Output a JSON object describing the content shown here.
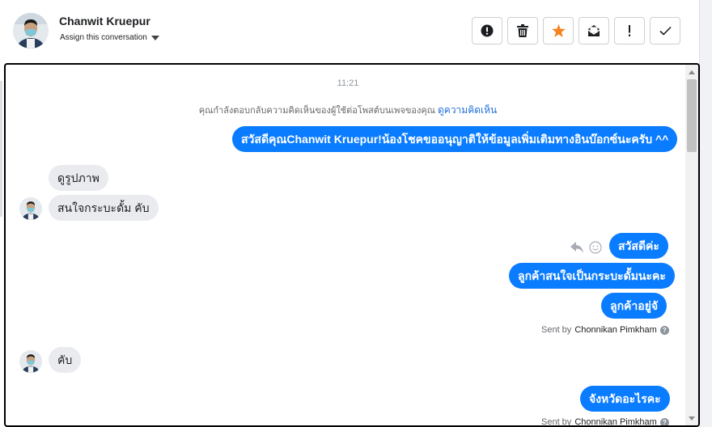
{
  "header": {
    "contact_name": "Chanwit Kruepur",
    "assign_label": "Assign this conversation",
    "toolbar": [
      {
        "icon": "alert-circle-icon"
      },
      {
        "icon": "trash-icon"
      },
      {
        "icon": "star-icon",
        "color": "#f5821f"
      },
      {
        "icon": "mail-icon"
      },
      {
        "icon": "exclamation-icon"
      },
      {
        "icon": "check-icon"
      }
    ]
  },
  "chat": {
    "timestamp": "11:21",
    "notice_text": "คุณกำลังตอบกลับความคิดเห็นของผู้ใช้ต่อโพสต์บนเพจของคุณ",
    "notice_link": "ดูความคิดเห็น",
    "messages": [
      {
        "dir": "out",
        "text": "สวัสดีคุณChanwit Kruepur!น้องโชคขออนุญาติให้ข้อมูลเพิ่มเติมทางอินบ๊อกซ์นะครับ ^^"
      },
      {
        "dir": "in",
        "text": "ดูรูปภาพ"
      },
      {
        "dir": "in",
        "text": "สนใจกระบะดั้ม คับ"
      },
      {
        "dir": "out",
        "text": "สวัสดีค่ะ"
      },
      {
        "dir": "out",
        "text": "ลูกค้าสนใจเป็นกระบะดั้มนะคะ"
      },
      {
        "dir": "out",
        "text": "ลูกค้าอยู่จั"
      },
      {
        "dir": "in",
        "text": "คับ"
      },
      {
        "dir": "out",
        "text": "จังหวัดอะไรคะ"
      }
    ],
    "sent_by": [
      {
        "prefix": "Sent by",
        "name": "Chonnikan Pimkham"
      },
      {
        "prefix": "Sent by",
        "name": "Chonnikan Pimkham"
      }
    ],
    "accent_color": "#0a7cff"
  }
}
